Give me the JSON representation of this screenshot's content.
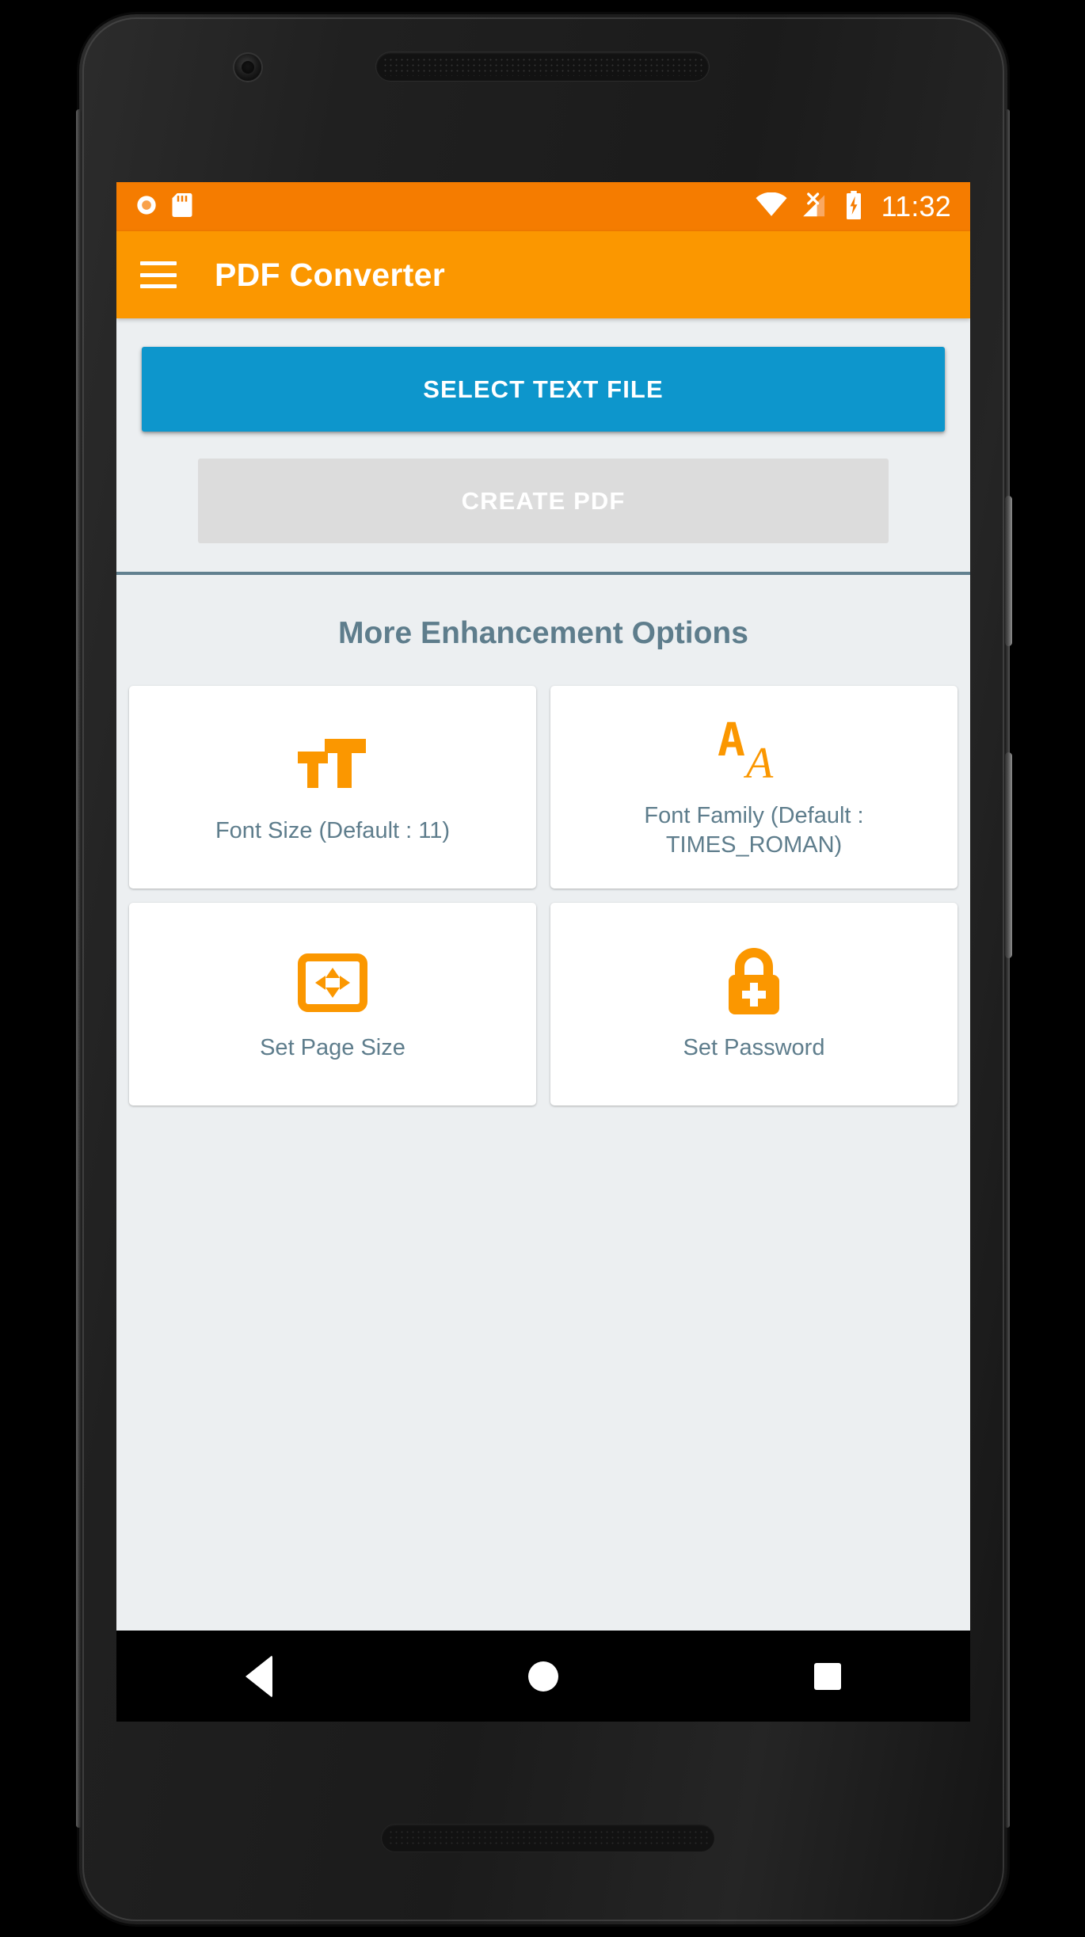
{
  "status_bar": {
    "icons_left": [
      "record-circle-icon",
      "sd-card-icon"
    ],
    "icons_right": [
      "wifi-icon",
      "no-sim-signal-icon",
      "battery-charging-icon"
    ],
    "time": "11:32",
    "background_color": "#f57c00"
  },
  "app_bar": {
    "menu_icon": "hamburger-menu-icon",
    "title": "PDF Converter",
    "background_color": "#fb9700"
  },
  "actions": {
    "select_file_label": "SELECT TEXT FILE",
    "select_file_color": "#0d96cc",
    "create_pdf_label": "CREATE PDF",
    "create_pdf_color": "#dcdcdc",
    "create_pdf_enabled": "false"
  },
  "section": {
    "title": "More Enhancement Options",
    "title_color": "#5e7d8c"
  },
  "options": [
    {
      "label": "Font Size (Default : 11)",
      "icon": "format-size-icon"
    },
    {
      "label": "Font Family (Default : TIMES_ROMAN)",
      "icon": "font-download-icon"
    },
    {
      "label": "Set Page Size",
      "icon": "page-size-arrows-icon"
    },
    {
      "label": "Set Password",
      "icon": "lock-plus-icon"
    }
  ],
  "theme": {
    "accent_orange": "#fb9700",
    "screen_background": "#eceff1",
    "divider_color": "#61808f",
    "card_background": "#ffffff"
  },
  "nav_bar": {
    "back": "back-triangle-icon",
    "home": "home-circle-icon",
    "recents": "recents-square-icon",
    "background_color": "#000000"
  }
}
